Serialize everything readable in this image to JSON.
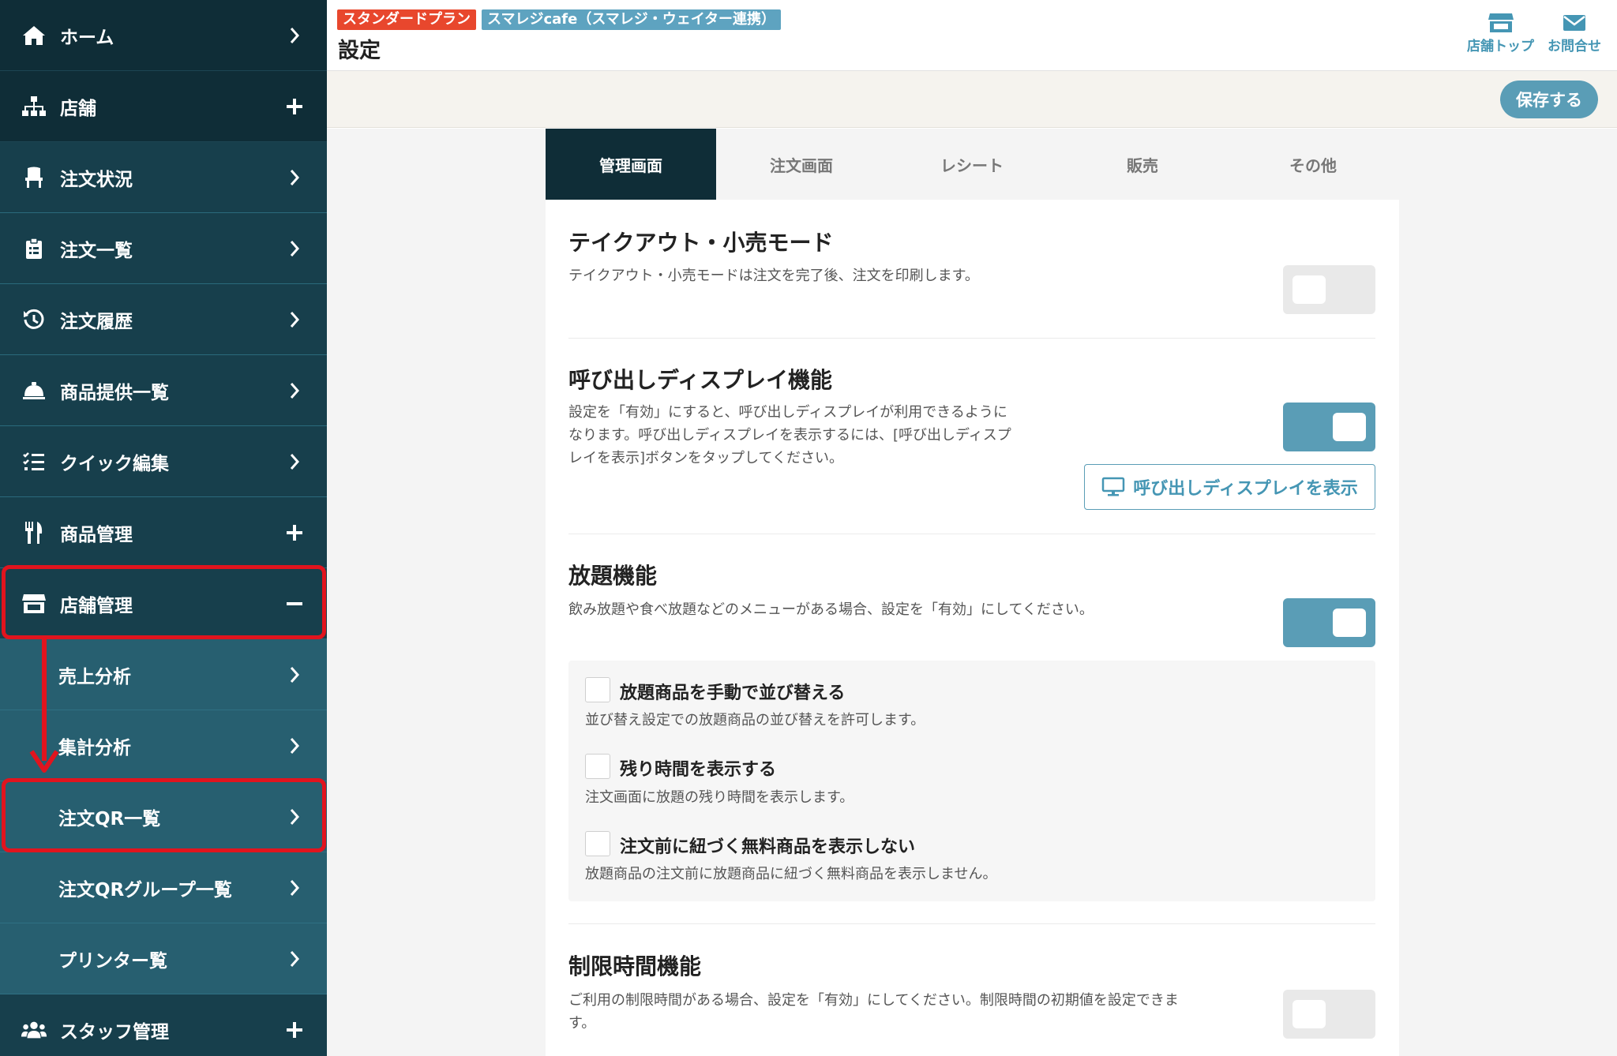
{
  "sidebar": {
    "items": [
      {
        "label": "ホーム",
        "icon": "home-icon",
        "tail": "chevron-right-icon"
      },
      {
        "label": "店舗",
        "icon": "sitemap-icon",
        "tail": "plus-icon"
      },
      {
        "label": "注文状況",
        "icon": "chair-icon",
        "tail": "chevron-right-icon"
      },
      {
        "label": "注文一覧",
        "icon": "clipboard-icon",
        "tail": "chevron-right-icon"
      },
      {
        "label": "注文履歴",
        "icon": "history-icon",
        "tail": "chevron-right-icon"
      },
      {
        "label": "商品提供一覧",
        "icon": "bell-icon",
        "tail": "chevron-right-icon"
      },
      {
        "label": "クイック編集",
        "icon": "list-check-icon",
        "tail": "chevron-right-icon"
      },
      {
        "label": "商品管理",
        "icon": "utensils-icon",
        "tail": "plus-icon"
      },
      {
        "label": "店舗管理",
        "icon": "store-icon",
        "tail": "minus-icon"
      },
      {
        "label": "売上分析",
        "icon": "",
        "tail": "chevron-right-icon"
      },
      {
        "label": "集計分析",
        "icon": "",
        "tail": "chevron-right-icon"
      },
      {
        "label": "注文QR一覧",
        "icon": "",
        "tail": "chevron-right-icon"
      },
      {
        "label": "注文QRグループ一覧",
        "icon": "",
        "tail": "chevron-right-icon"
      },
      {
        "label": "プリンター覧",
        "icon": "",
        "tail": "chevron-right-icon"
      },
      {
        "label": "スタッフ管理",
        "icon": "users-icon",
        "tail": "plus-icon"
      }
    ]
  },
  "header": {
    "plan_badge": "スタンダードプラン",
    "shop_badge": "スマレジcafe（スマレジ・ウェイター連携）",
    "title": "設定",
    "links": [
      {
        "label": "店舗トップ",
        "icon": "store-icon"
      },
      {
        "label": "お問合せ",
        "icon": "envelope-icon"
      }
    ]
  },
  "toolbar": {
    "save_label": "保存する"
  },
  "tabs": [
    {
      "label": "管理画面",
      "active": true
    },
    {
      "label": "注文画面",
      "active": false
    },
    {
      "label": "レシート",
      "active": false
    },
    {
      "label": "販売",
      "active": false
    },
    {
      "label": "その他",
      "active": false
    }
  ],
  "sections": {
    "takeout": {
      "title": "テイクアウト・小売モード",
      "desc": "テイクアウト・小売モードは注文を完了後、注文を印刷します。",
      "enabled": false
    },
    "call_display": {
      "title": "呼び出しディスプレイ機能",
      "desc_lines": [
        "設定を「有効」にすると、呼び出しディスプレイが利用できるように",
        "なります。呼び出しディスプレイを表示するには、[呼び出しディスプ",
        "レイを表示]ボタンをタップしてください。"
      ],
      "enabled": true,
      "button_label": "呼び出しディスプレイを表示"
    },
    "all_you_can": {
      "title": "放題機能",
      "desc": "飲み放題や食べ放題などのメニューがある場合、設定を「有効」にしてください。",
      "enabled": true,
      "options": [
        {
          "label": "放題商品を手動で並び替える",
          "desc": "並び替え設定での放題商品の並び替えを許可します。",
          "checked": false
        },
        {
          "label": "残り時間を表示する",
          "desc": "注文画面に放題の残り時間を表示します。",
          "checked": false
        },
        {
          "label": "注文前に紐づく無料商品を表示しない",
          "desc": "放題商品の注文前に放題商品に紐づく無料商品を表示しません。",
          "checked": false
        }
      ]
    },
    "time_limit": {
      "title": "制限時間機能",
      "desc_lines": [
        "ご利用の制限時間がある場合、設定を「有効」にしてください。制限時間の初期値を設定できま",
        "す。"
      ],
      "enabled": false
    }
  },
  "colors": {
    "accent": "#5a9db6",
    "sidebar": "#1f4f5e",
    "highlight": "#e1141e",
    "plan_badge": "#e8472d"
  }
}
